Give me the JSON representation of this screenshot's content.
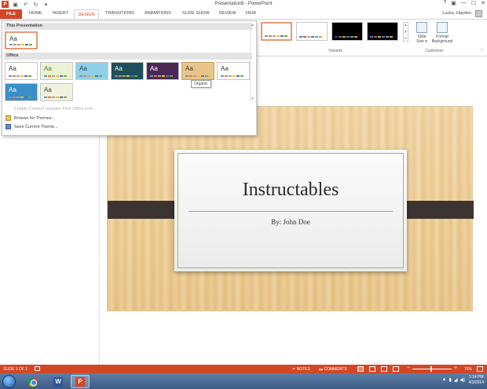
{
  "window": {
    "title": "Presentation8 - PowerPoint",
    "controls": [
      "?",
      "▣",
      "—",
      "☐",
      "✕"
    ]
  },
  "quick_access": [
    "save-icon",
    "undo-icon",
    "redo-icon",
    "customize-icon"
  ],
  "ribbon": {
    "tabs": [
      {
        "id": "file",
        "label": "FILE"
      },
      {
        "id": "home",
        "label": "HOME"
      },
      {
        "id": "insert",
        "label": "INSERT"
      },
      {
        "id": "design",
        "label": "DESIGN",
        "active": true
      },
      {
        "id": "transitions",
        "label": "TRANSITIONS"
      },
      {
        "id": "animations",
        "label": "ANIMATIONS"
      },
      {
        "id": "slideshow",
        "label": "SLIDE SHOW"
      },
      {
        "id": "review",
        "label": "REVIEW"
      },
      {
        "id": "view",
        "label": "VIEW"
      }
    ],
    "user": "Lucke, Hayden",
    "groups": {
      "variants": "Variants",
      "customize": "Customize"
    },
    "buttons": {
      "slide_size": "Slide Size ▾",
      "format_background": "Format Background"
    },
    "variant_colors": [
      {
        "bg": "#ffffff",
        "strip": [
          "#5b9bd5",
          "#ed7d31",
          "#a5a5a5",
          "#ffc000",
          "#4472c4",
          "#70ad47"
        ]
      },
      {
        "bg": "#ffffff",
        "strip": [
          "#4f81bd",
          "#c0504d",
          "#9bbb59",
          "#8064a2",
          "#4bacc6",
          "#f79646"
        ]
      },
      {
        "bg": "#000000",
        "strip": [
          "#1f497d",
          "#c0504d",
          "#9bbb59",
          "#8064a2",
          "#4bacc6",
          "#f79646"
        ]
      },
      {
        "bg": "#000000",
        "strip": [
          "#4f81bd",
          "#c0504d",
          "#9bbb59",
          "#8064a2",
          "#4bacc6",
          "#f79646"
        ]
      }
    ]
  },
  "theme_dropdown": {
    "section_this": "This Presentation",
    "section_office": "Office",
    "tooltip": "Organic",
    "commands": {
      "enable_updates": "Enable Content Updates from Office.com...",
      "browse": "Browse for Themes...",
      "save": "Save Current Theme..."
    },
    "tiles_this": [
      {
        "label": "Aa",
        "bg": "#ffffff",
        "fg": "#333333",
        "selected": true
      }
    ],
    "tiles_office": [
      {
        "label": "Aa",
        "bg": "#ffffff",
        "fg": "#333333"
      },
      {
        "label": "Aa",
        "bg": "#e9f3d3",
        "fg": "#4a7a1c"
      },
      {
        "label": "Aa",
        "bg": "#8fd0e8",
        "fg": "#1d3b55"
      },
      {
        "label": "Aa",
        "bg": "#1f4f5a",
        "fg": "#ffffff"
      },
      {
        "label": "Aa",
        "bg": "#4a2a55",
        "fg": "#ffffff"
      },
      {
        "label": "Aa",
        "bg": "#e8c48a",
        "fg": "#333333",
        "hover": true
      },
      {
        "label": "Aa",
        "bg": "#ffffff",
        "fg": "#333333"
      },
      {
        "label": "Aa",
        "bg": "#3a8fc8",
        "fg": "#ffffff"
      },
      {
        "label": "Aa",
        "bg": "#f1f1df",
        "fg": "#3a3a2a"
      }
    ]
  },
  "slide": {
    "title": "Instructables",
    "subtitle": "By: John Doe"
  },
  "status": {
    "slide": "SLIDE 1 OF 1",
    "notes": "≐ NOTES",
    "comments": "▬ COMMENTS",
    "zoom": "76%"
  },
  "taskbar": {
    "clock_time": "1:14 PM",
    "clock_date": "4/3/2014",
    "tray": [
      "▲",
      "▮",
      "◢",
      "◀)"
    ]
  }
}
